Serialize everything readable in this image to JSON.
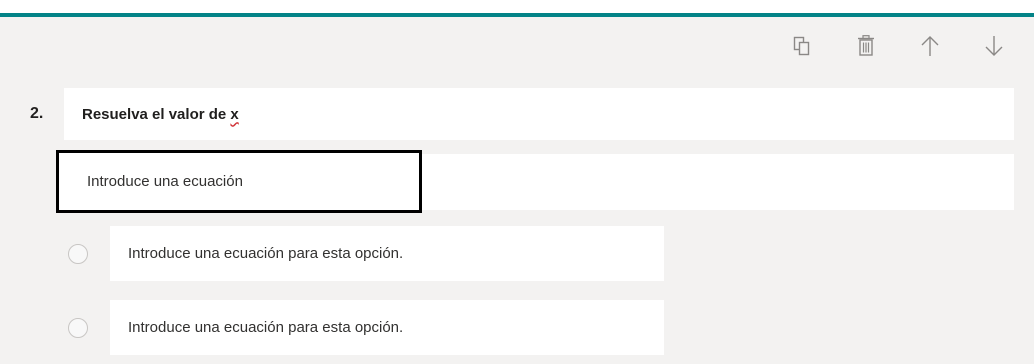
{
  "question": {
    "number": "2.",
    "title_prefix": "Resuelva el valor de ",
    "title_variable": "x",
    "equation_placeholder": "Introduce una ecuación"
  },
  "options": [
    {
      "placeholder": "Introduce una ecuación para esta opción."
    },
    {
      "placeholder": "Introduce una ecuación para esta opción."
    }
  ],
  "toolbar": {
    "icons": [
      "copy-icon",
      "delete-icon",
      "arrow-up-icon",
      "arrow-down-icon"
    ]
  },
  "colors": {
    "accent": "#038387",
    "card_background": "#f3f2f1",
    "spellcheck_underline": "#d13438"
  }
}
